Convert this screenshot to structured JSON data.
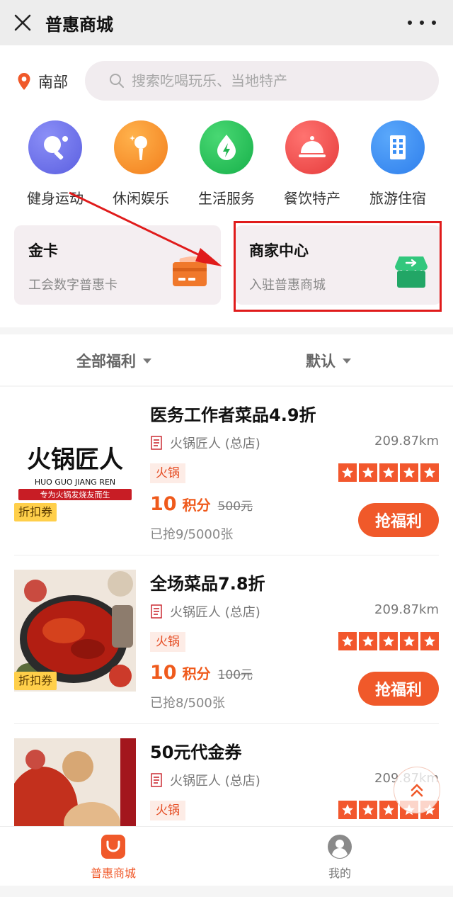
{
  "window": {
    "title": "普惠商城",
    "close_icon": "close-icon",
    "more_icon": "more-dots-icon"
  },
  "header": {
    "location": "南部",
    "search_placeholder": "搜索吃喝玩乐、当地特产"
  },
  "categories": [
    {
      "label": "健身运动",
      "icon": "ping-pong-icon",
      "color": "#6e72ee"
    },
    {
      "label": "休闲娱乐",
      "icon": "microphone-icon",
      "color": "#f6922c"
    },
    {
      "label": "生活服务",
      "icon": "lightning-drop-icon",
      "color": "#29c257"
    },
    {
      "label": "餐饮特产",
      "icon": "food-cloche-icon",
      "color": "#f0504e"
    },
    {
      "label": "旅游住宿",
      "icon": "building-icon",
      "color": "#3a8ff5"
    }
  ],
  "cards": {
    "gold": {
      "title": "金卡",
      "subtitle": "工会数字普惠卡"
    },
    "merchant": {
      "title": "商家中心",
      "subtitle": "入驻普惠商城"
    }
  },
  "filter": {
    "left": "全部福利",
    "right": "默认"
  },
  "items": [
    {
      "name": "医务工作者菜品4.9折",
      "shop": "火锅匠人 (总店)",
      "distance": "209.87km",
      "category": "火锅",
      "badge": "折扣券",
      "points": "10",
      "points_unit": "积分",
      "original_price": "500元",
      "sold": "已抢9/5000张",
      "button": "抢福利",
      "logo": {
        "big": "火锅匠人",
        "pinyin": "HUO GUO JIANG REN",
        "slogan": "专为火锅发烧友而生"
      }
    },
    {
      "name": "全场菜品7.8折",
      "shop": "火锅匠人 (总店)",
      "distance": "209.87km",
      "category": "火锅",
      "badge": "折扣券",
      "points": "10",
      "points_unit": "积分",
      "original_price": "100元",
      "sold": "已抢8/500张",
      "button": "抢福利"
    },
    {
      "name": "50元代金券",
      "shop": "火锅匠人 (总店)",
      "distance": "209.87km",
      "category": "火锅"
    }
  ],
  "tabs": [
    {
      "label": "普惠商城",
      "icon": "mall-bag-icon",
      "active": true,
      "color": "#f0592a"
    },
    {
      "label": "我的",
      "icon": "user-icon",
      "active": false,
      "color": "#777777"
    }
  ]
}
